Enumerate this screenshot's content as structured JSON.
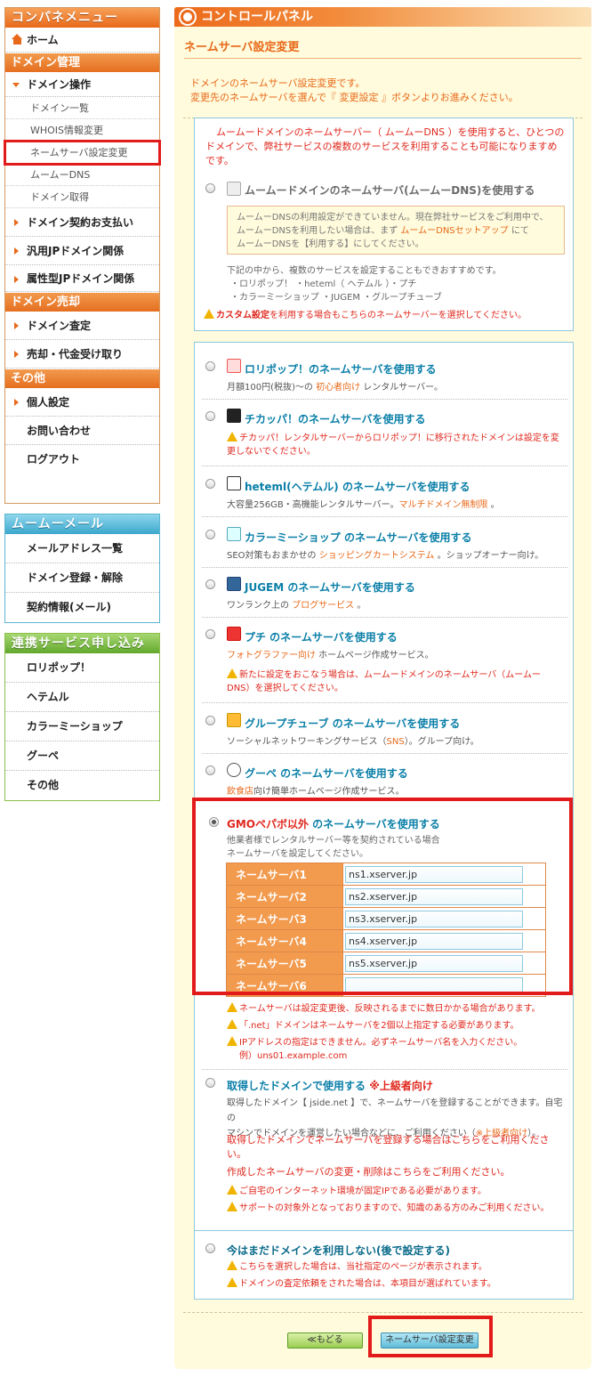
{
  "sidebar": {
    "header": "コンパネメニュー",
    "home": "ホーム",
    "sec_domain": "ドメイン管理",
    "domain_ops": "ドメイン操作",
    "leaves": [
      "ドメイン一覧",
      "WHOIS情報変更",
      "ネームサーバ設定変更",
      "ムームーDNS",
      "ドメイン取得"
    ],
    "contract": "ドメイン契約お支払い",
    "jp": "汎用JPドメイン関係",
    "attr_jp": "属性型JPドメイン関係",
    "sec_sale": "ドメイン売却",
    "appraisal": "ドメイン査定",
    "sale": "売却・代金受け取り",
    "sec_other": "その他",
    "personal": "個人設定",
    "contact": "お問い合わせ",
    "logout": "ログアウト",
    "mail_header": "ムームーメール",
    "mail_items": [
      "メールアドレス一覧",
      "ドメイン登録・解除",
      "契約情報(メール)"
    ],
    "link_header": "連携サービス申し込み",
    "link_items": [
      "ロリポップ！",
      "ヘテムル",
      "カラーミーショップ",
      "グーペ",
      "その他"
    ]
  },
  "main": {
    "panel_title": "コントロールパネル",
    "page_title": "ネームサーバ設定変更",
    "intro1": "ドメインのネームサーバ設定変更です。",
    "intro2": "変更先のネームサーバを選んで『 変更設定 』ボタンよりお進みください。"
  },
  "muumuu": {
    "desc": "ムームードメインのネームサーバー（ ムームーDNS ）を使用すると、ひとつのドメインで、弊社サービスの複数のサービスを利用することも可能になりますめです。",
    "label": "ムームードメインのネームサーバ(ムームーDNS)を使用する",
    "note1": "ムームーDNSの利用設定ができていません。現在弊社サービスをご利用中で、",
    "note2a": "ムームーDNSを利用したい場合は、まず ",
    "note2b": "ムームーDNSセットアップ",
    "note2c": " にて",
    "note3": "ムームーDNSを【利用する】にしてください。",
    "sub1": "下記の中から、複数のサービスを設定することもできおすすめです。",
    "sub2": "・ロリポップ！ ・heteml（ ヘテムル ）・プチ",
    "sub3": "・カラーミーショップ ・JUGEM ・グループチューブ",
    "warn_a": "カスタム設定",
    "warn_b": "を利用する場合もこちらのネームサーバーを選択してください。"
  },
  "options": {
    "lolipop": {
      "label": "ロリポップ！のネームサーバを使用する",
      "sub_a": "月額100円(税抜)～の ",
      "sub_b": "初心者向け",
      "sub_c": " レンタルサーバー。"
    },
    "chicappa": {
      "label": "チカッパ！のネームサーバを使用する",
      "warn1": "チカッパ！レンタルサーバーからロリポップ！に移行されたドメインは設定を変",
      "warn2": "更しないでください。"
    },
    "heteml": {
      "label": "heteml(ヘテムル) のネームサーバを使用する",
      "sub_a": "大容量256GB・高機能レンタルサーバー。",
      "sub_b": "マルチドメイン無制限",
      "sub_c": " 。"
    },
    "colorme": {
      "label": "カラーミーショップ のネームサーバを使用する",
      "sub_a": "SEO対策もおまかせの ",
      "sub_b": "ショッピングカートシステム",
      "sub_c": " 。ショップオーナー向け。"
    },
    "jugem": {
      "label": "JUGEM のネームサーバを使用する",
      "sub_a": "ワンランク上の ",
      "sub_b": "ブログサービス",
      "sub_c": " 。"
    },
    "petit": {
      "label": "プチ のネームサーバを使用する",
      "sub_a": "フォトグラファー向け",
      "sub_b": " ホームページ作成サービス。",
      "warn1": "新たに設定をおこなう場合は、ムームードメインのネームサーバ（ムームー",
      "warn2": "DNS）を選択してください。"
    },
    "grouptube": {
      "label": "グループチューブ のネームサーバを使用する",
      "sub_a": "ソーシャルネットワーキングサービス（",
      "sub_b": "SNS",
      "sub_c": "）。グループ向け。"
    },
    "goope": {
      "label": "グーペ のネームサーバを使用する",
      "sub_a": "飲食店",
      "sub_b": "向け簡単ホームページ作成サービス。"
    },
    "gmo": {
      "label_a": "GMOペパボ以外",
      "label_b": " のネームサーバを使用する",
      "sub1": "他業者様でレンタルサーバー等を契約されている場合",
      "sub2": "ネームサーバを設定してください。",
      "rows": [
        {
          "label": "ネームサーバ1",
          "value": "ns1.xserver.jp"
        },
        {
          "label": "ネームサーバ2",
          "value": "ns2.xserver.jp"
        },
        {
          "label": "ネームサーバ3",
          "value": "ns3.xserver.jp"
        },
        {
          "label": "ネームサーバ4",
          "value": "ns4.xserver.jp"
        },
        {
          "label": "ネームサーバ5",
          "value": "ns5.xserver.jp"
        },
        {
          "label": "ネームサーバ6",
          "value": ""
        }
      ],
      "warn1": "ネームサーバは設定変更後、反映されるまでに数日かかる場合があります。",
      "warn2": "「.net」ドメインはネームサーバを2個以上指定する必要があります。",
      "warn3": "IPアドレスの指定はできません。必ずネームサーバ名を入力ください。",
      "warn3b": "例）uns01.example.com"
    },
    "own": {
      "label_a": "取得したドメインで使用する",
      "label_b": " ※上級者向け",
      "sub1": "取得したドメイン【 jside.net 】で、ネームサーバを登録することができます。自宅の",
      "sub2a": "マシンでドメインを運営したい場合などに、ご利用ください（",
      "sub2b": "※上級者向け",
      "sub2c": "）。",
      "link1a": "取得したドメインでネームサーバを登録する場合はこちらをご利用くださ",
      "link1b": "い。",
      "link2": "作成したネームサーバの変更・削除はこちらをご利用ください。",
      "warn1": "ご自宅のインターネット環境が固定IPである必要があります。",
      "warn2": "サポートの対象外となっておりますので、知識のある方のみご利用ください。"
    },
    "later": {
      "label": "今はまだドメインを利用しない(後で設定する)",
      "warn1": "こちらを選択した場合は、当社指定のページが表示されます。",
      "warn2": "ドメインの査定依頼をされた場合は、本項目が選ばれています。"
    }
  },
  "buttons": {
    "back": "≪もどる",
    "submit": "ネームサーバ設定変更"
  }
}
